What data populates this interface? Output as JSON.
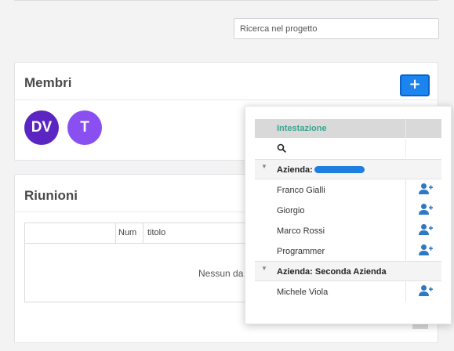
{
  "search": {
    "placeholder": "Ricerca nel progetto"
  },
  "members_card": {
    "title": "Membri",
    "add_button_label": "+",
    "avatars": [
      {
        "initials": "DV",
        "color": "#5b25c1"
      },
      {
        "initials": "T",
        "color": "#8a4ff0"
      }
    ]
  },
  "meetings_card": {
    "title": "Riunioni",
    "columns": [
      "",
      "Num",
      "titolo"
    ],
    "empty_message": "Nessun da"
  },
  "member_picker": {
    "header": "Intestazione",
    "groups": [
      {
        "label": "Azienda:",
        "name_redacted": true,
        "members": [
          "Franco Gialli",
          "Giorgio",
          "Marco Rossi",
          "Programmer"
        ]
      },
      {
        "label": "Azienda: Seconda Azienda",
        "name_redacted": false,
        "members": [
          "Michele Viola"
        ]
      }
    ]
  },
  "icons": {
    "search": "search-icon",
    "add_member": "user-plus-icon",
    "collapse": "caret-down-icon"
  },
  "colors": {
    "primary": "#1c84ee",
    "accent_teal": "#3aa590",
    "icon_blue": "#2f78c4"
  }
}
